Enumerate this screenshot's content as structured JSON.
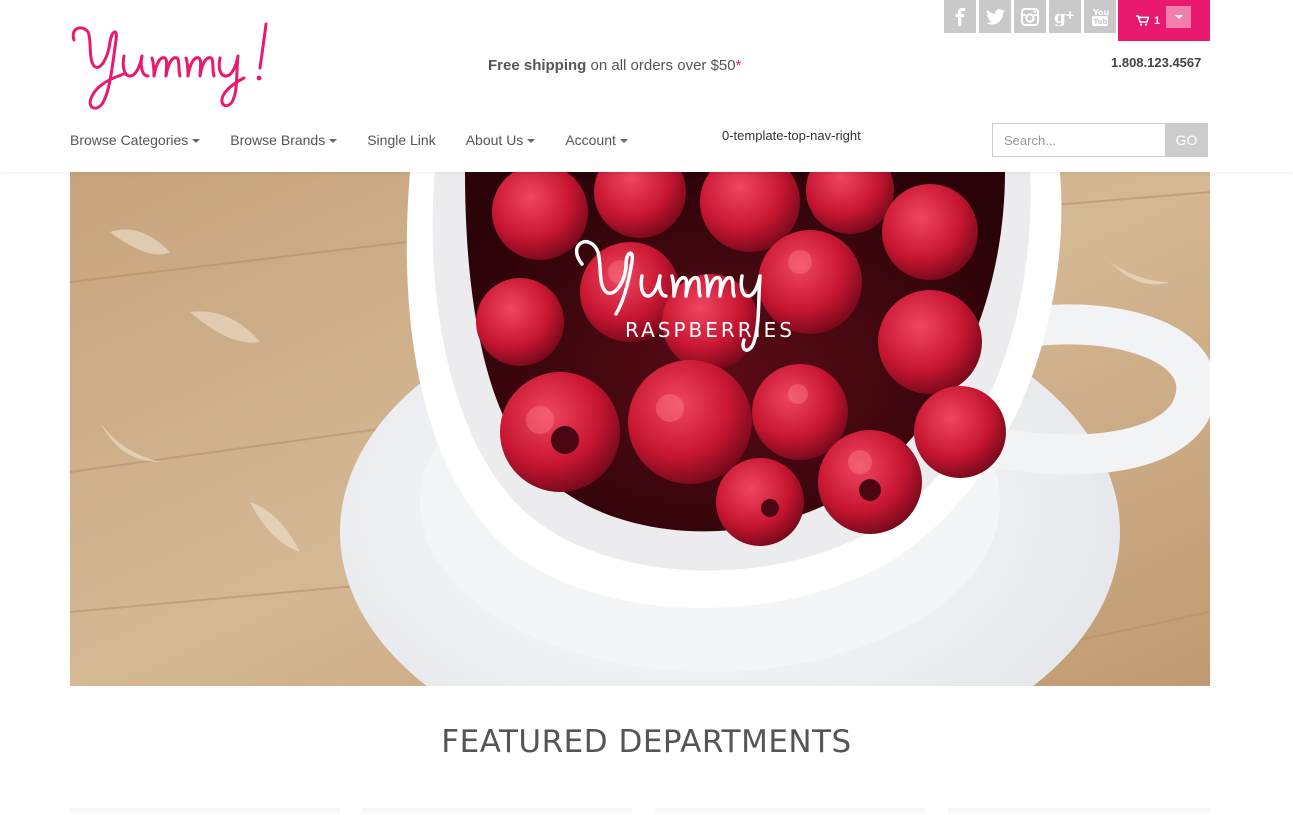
{
  "brand": {
    "logo_text": "Yummy!",
    "accent_color": "#e8196e"
  },
  "promo": {
    "bold": "Free shipping",
    "rest": " on all orders over $50",
    "star": "*"
  },
  "phone": "1.808.123.4567",
  "social": [
    {
      "icon": "facebook-icon"
    },
    {
      "icon": "twitter-icon"
    },
    {
      "icon": "instagram-icon"
    },
    {
      "icon": "google-plus-icon"
    },
    {
      "icon": "youtube-icon"
    }
  ],
  "cart": {
    "count": "1",
    "icon": "cart-icon"
  },
  "nav": {
    "items": [
      {
        "label": "Browse Categories"
      },
      {
        "label": "Browse Brands"
      },
      {
        "label": "Single Link"
      },
      {
        "label": "About Us"
      },
      {
        "label": "Account"
      }
    ],
    "right_text": "0-template-top-nav-right"
  },
  "search": {
    "placeholder": "Search...",
    "button_label": "GO"
  },
  "hero": {
    "title": "Yummy",
    "subtitle": "RASPBERRIES"
  },
  "featured": {
    "title": "FEATURED DEPARTMENTS"
  }
}
